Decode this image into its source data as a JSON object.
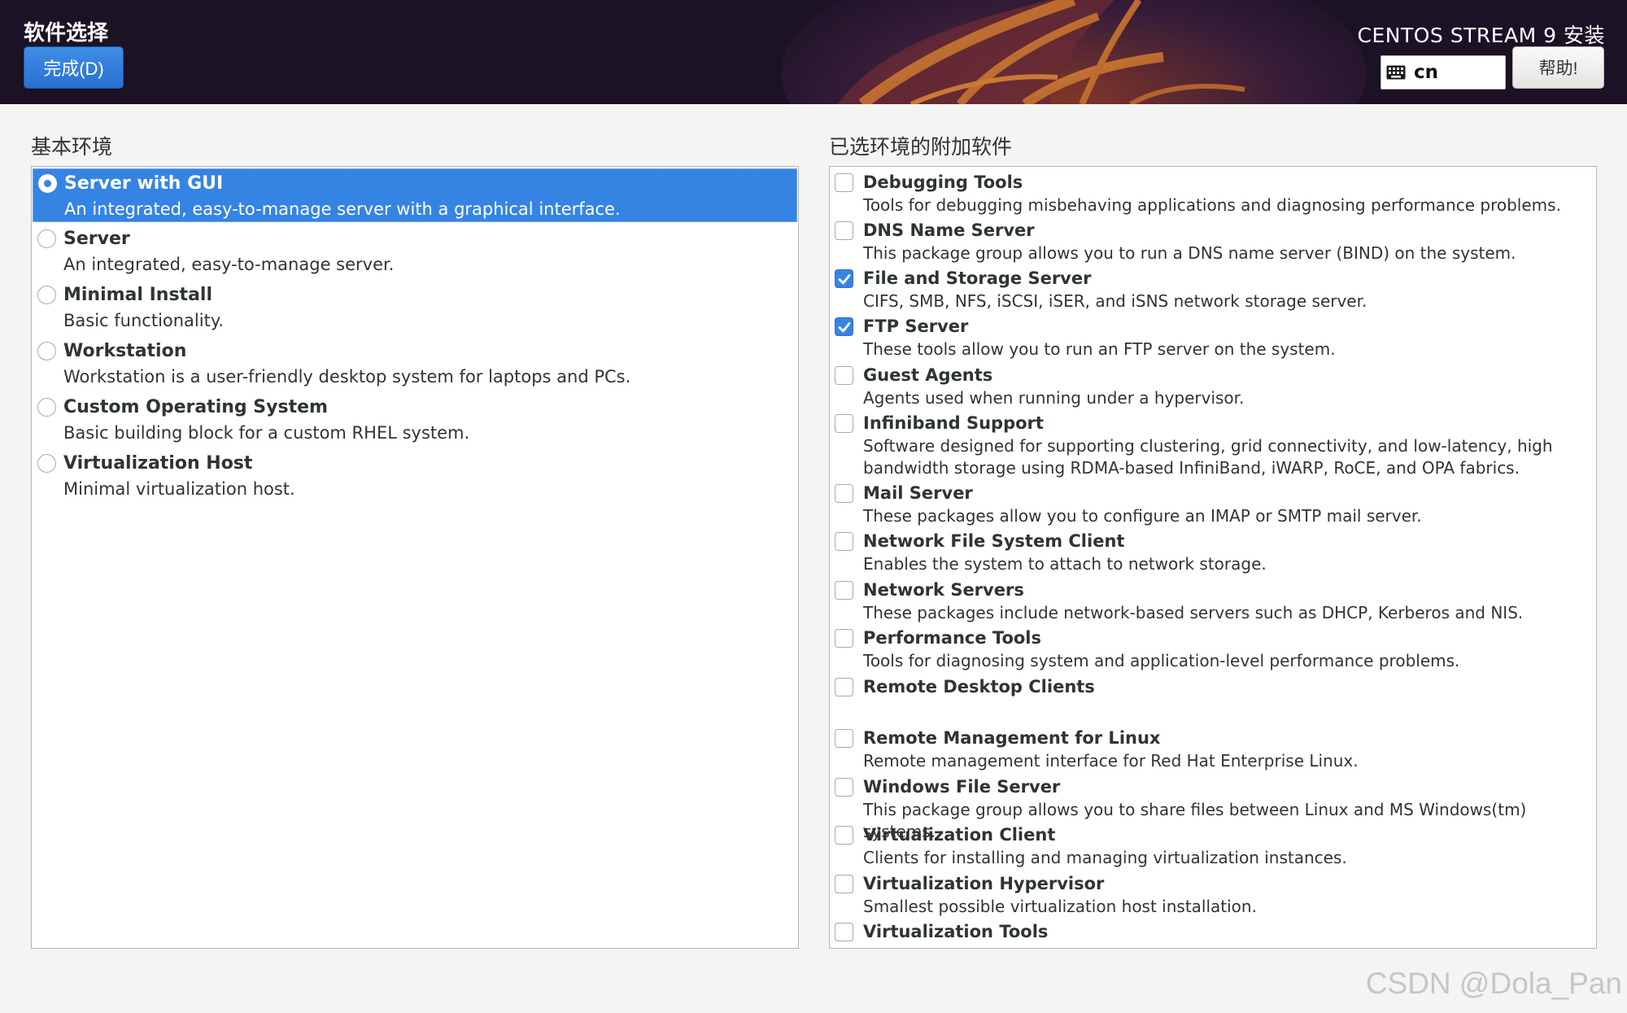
{
  "header": {
    "page_title": "软件选择",
    "done_label": "完成(D)",
    "product_title": "CENTOS STREAM 9 安装",
    "keyboard_layout": "cn",
    "keyboard_icon": "keyboard-icon",
    "help_label": "帮助!"
  },
  "colors": {
    "accent": "#3584e4",
    "banner_background": "#1c1226"
  },
  "base_environment": {
    "heading": "基本环境",
    "items": [
      {
        "name": "Server with GUI",
        "desc": "An integrated, easy-to-manage server with a graphical interface.",
        "selected": true
      },
      {
        "name": "Server",
        "desc": "An integrated, easy-to-manage server.",
        "selected": false
      },
      {
        "name": "Minimal Install",
        "desc": "Basic functionality.",
        "selected": false
      },
      {
        "name": "Workstation",
        "desc": "Workstation is a user-friendly desktop system for laptops and PCs.",
        "selected": false
      },
      {
        "name": "Custom Operating System",
        "desc": "Basic building block for a custom RHEL system.",
        "selected": false
      },
      {
        "name": "Virtualization Host",
        "desc": "Minimal virtualization host.",
        "selected": false
      }
    ]
  },
  "addons": {
    "heading": "已选环境的附加软件",
    "items": [
      {
        "name": "Debugging Tools",
        "desc": "Tools for debugging misbehaving applications and diagnosing performance problems.",
        "checked": false
      },
      {
        "name": "DNS Name Server",
        "desc": "This package group allows you to run a DNS name server (BIND) on the system.",
        "checked": false
      },
      {
        "name": "File and Storage Server",
        "desc": "CIFS, SMB, NFS, iSCSI, iSER, and iSNS network storage server.",
        "checked": true
      },
      {
        "name": "FTP Server",
        "desc": "These tools allow you to run an FTP server on the system.",
        "checked": true
      },
      {
        "name": "Guest Agents",
        "desc": "Agents used when running under a hypervisor.",
        "checked": false
      },
      {
        "name": "Infiniband Support",
        "desc": "Software designed for supporting clustering, grid connectivity, and low-latency, high bandwidth storage using RDMA-based InfiniBand, iWARP, RoCE, and OPA fabrics.",
        "checked": false
      },
      {
        "name": "Mail Server",
        "desc": "These packages allow you to configure an IMAP or SMTP mail server.",
        "checked": false
      },
      {
        "name": "Network File System Client",
        "desc": "Enables the system to attach to network storage.",
        "checked": false
      },
      {
        "name": "Network Servers",
        "desc": "These packages include network-based servers such as DHCP, Kerberos and NIS.",
        "checked": false
      },
      {
        "name": "Performance Tools",
        "desc": "Tools for diagnosing system and application-level performance problems.",
        "checked": false
      },
      {
        "name": "Remote Desktop Clients",
        "desc": "",
        "checked": false
      },
      {
        "name": "Remote Management for Linux",
        "desc": "Remote management interface for Red Hat Enterprise Linux.",
        "checked": false
      },
      {
        "name": "Windows File Server",
        "desc": "This package group allows you to share files between Linux and MS Windows(tm) systems.",
        "checked": false
      },
      {
        "name": "Virtualization Client",
        "desc": "Clients for installing and managing virtualization instances.",
        "checked": false
      },
      {
        "name": "Virtualization Hypervisor",
        "desc": "Smallest possible virtualization host installation.",
        "checked": false
      },
      {
        "name": "Virtualization Tools",
        "desc": "",
        "checked": false
      }
    ]
  },
  "watermark": "CSDN @Dola_Pan"
}
